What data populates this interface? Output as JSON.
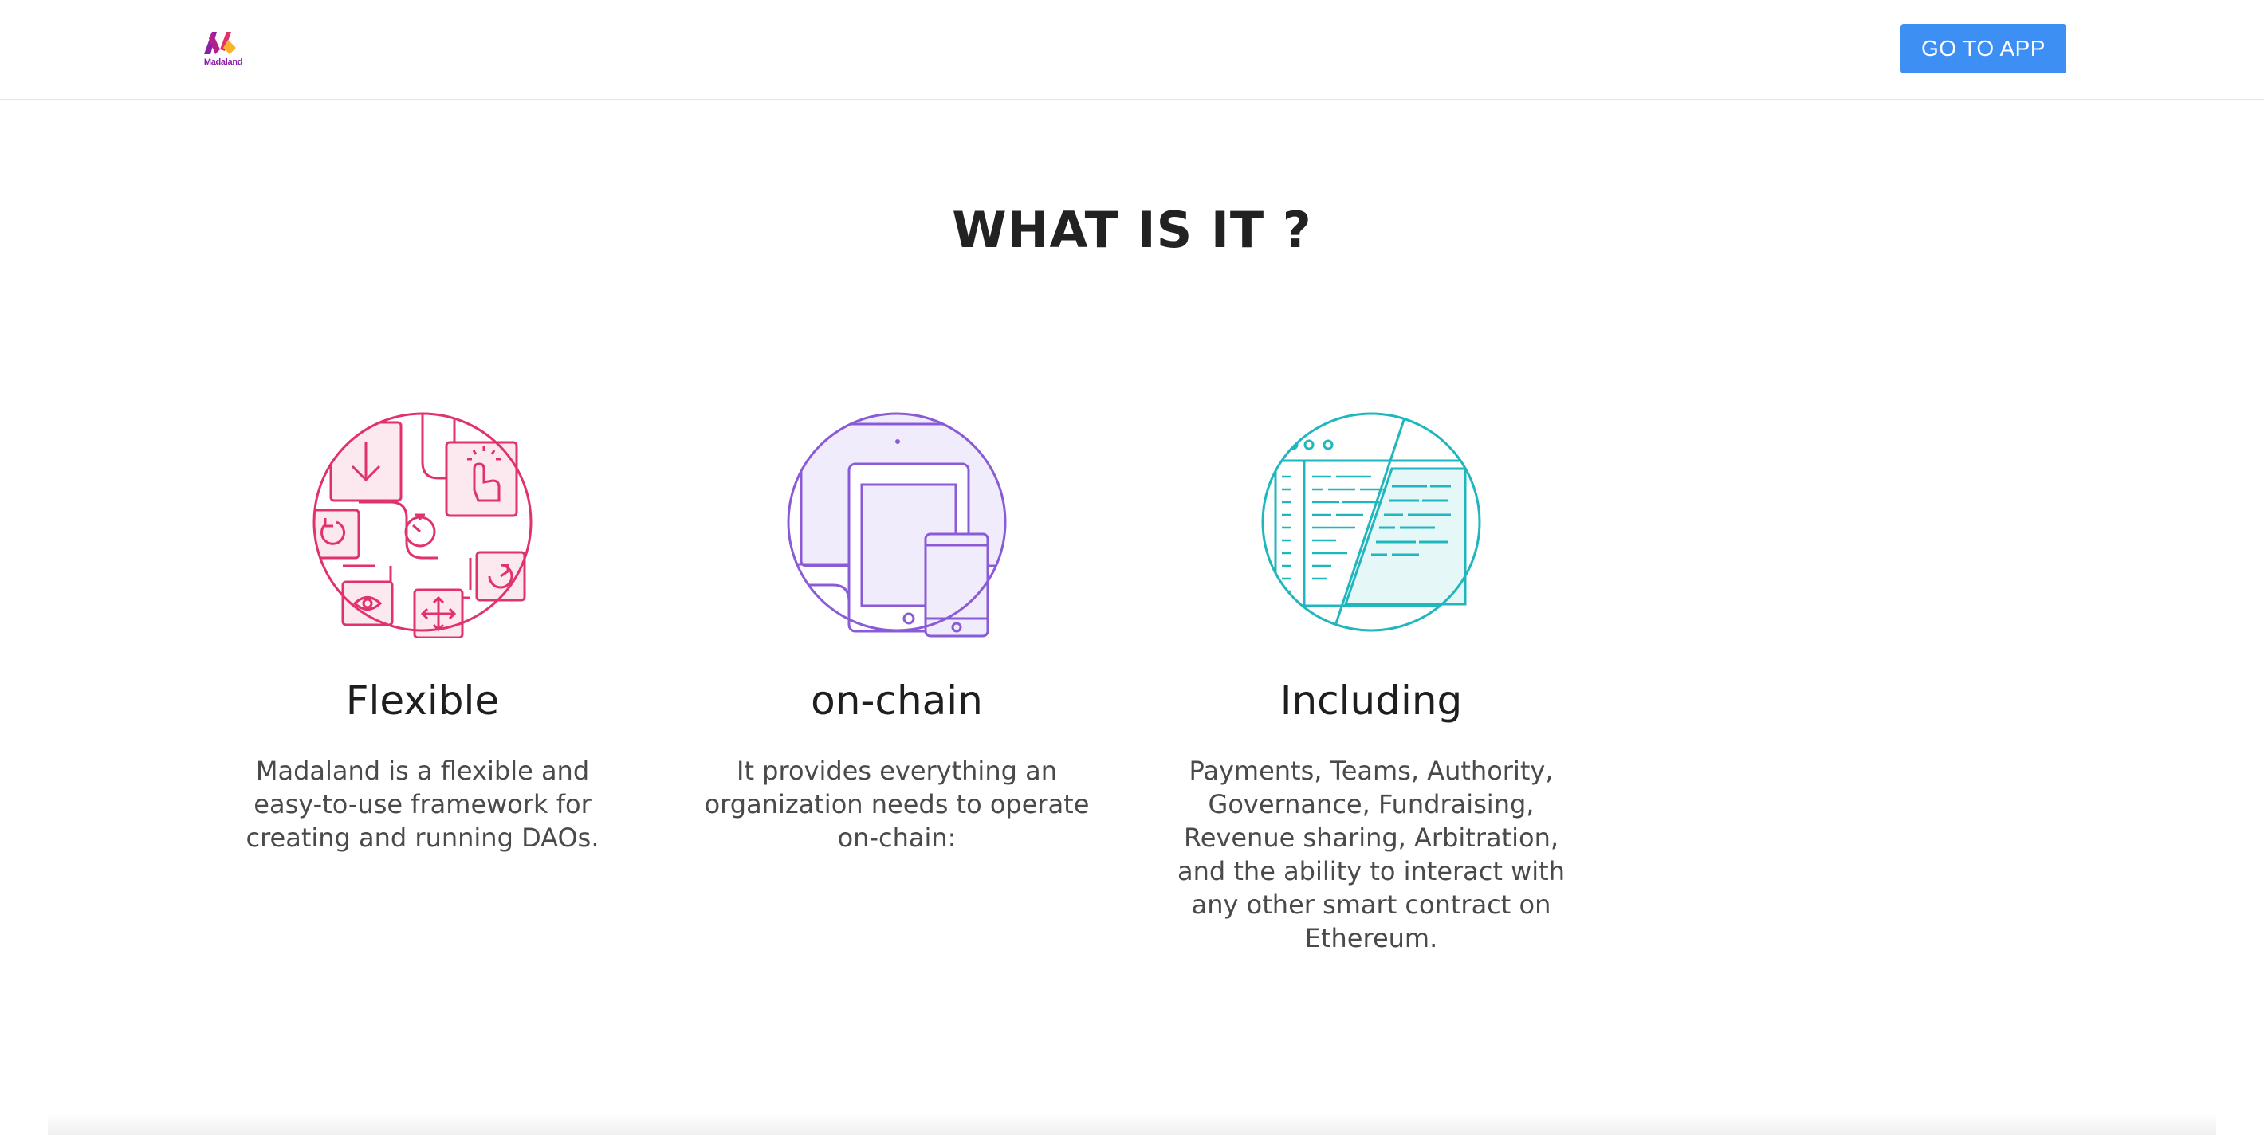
{
  "header": {
    "logo_text": "Madaland",
    "cta_label": "GO TO APP",
    "cta_color": "#3d8ff3"
  },
  "section": {
    "title": "WHAT IS IT ?"
  },
  "features": [
    {
      "icon": "modules-circle-icon",
      "color": "#e0326e",
      "title": "Flexible",
      "description": "Madaland is a flexible and easy-to-use framework for creating and running DAOs."
    },
    {
      "icon": "devices-circle-icon",
      "color": "#8a5bd6",
      "title": "on-chain",
      "description": "It provides everything an organization needs to operate on-chain:"
    },
    {
      "icon": "code-window-circle-icon",
      "color": "#1fb7bd",
      "title": "Including",
      "description": "Payments, Teams, Authority, Governance, Fundraising, Revenue sharing, Arbitration, and the ability to interact with any other smart contract on Ethereum."
    }
  ]
}
